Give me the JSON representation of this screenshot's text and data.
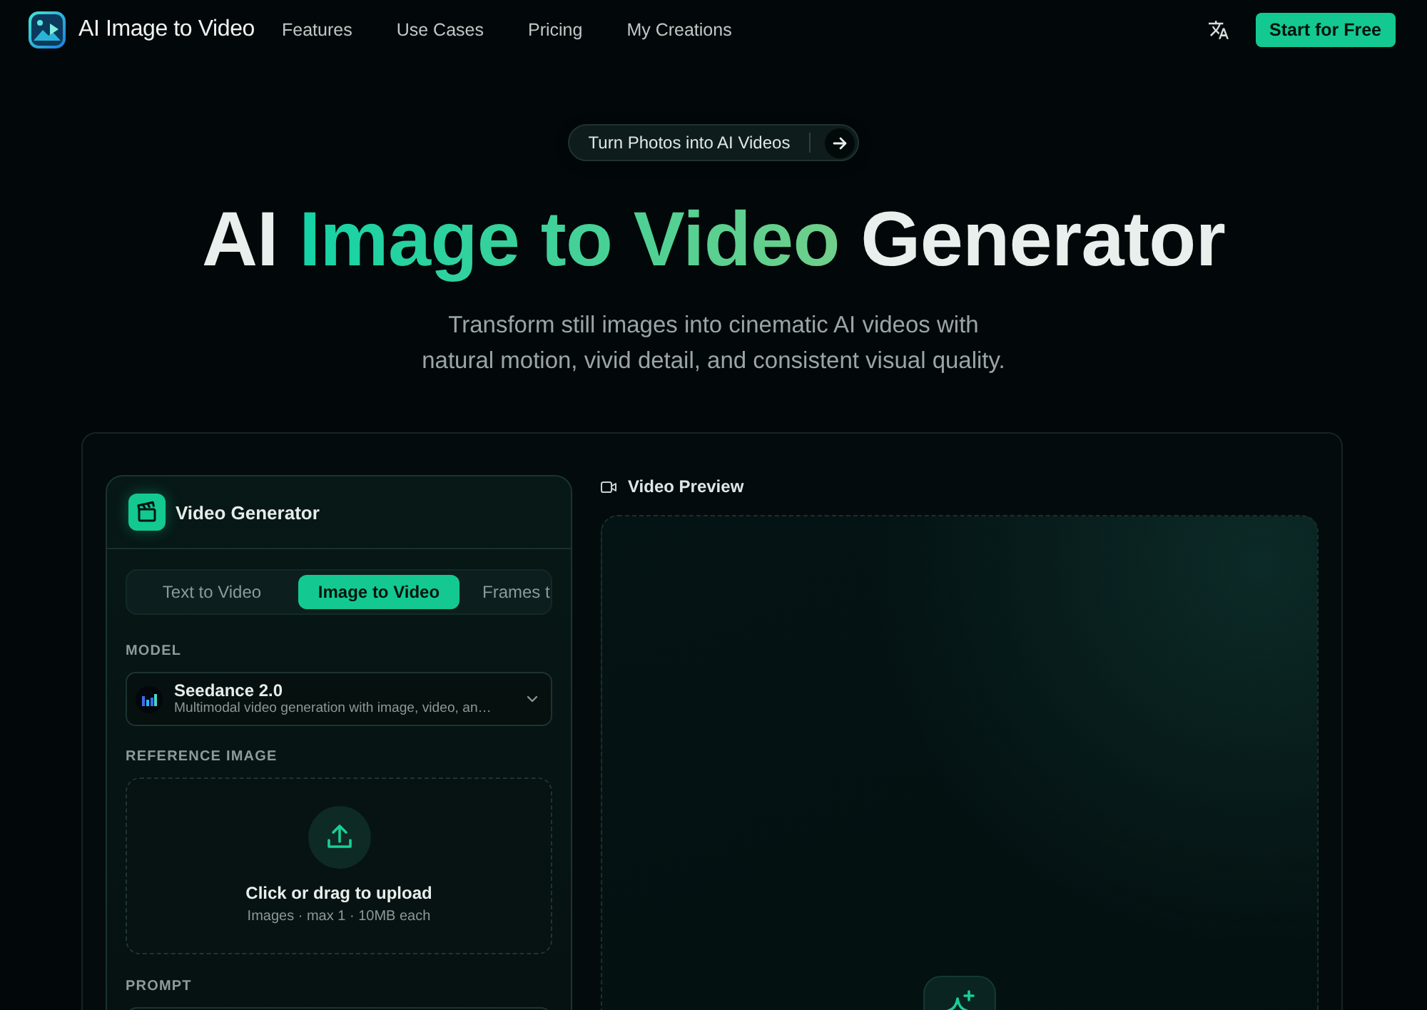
{
  "header": {
    "brand": "AI Image to Video",
    "nav": [
      "Features",
      "Use Cases",
      "Pricing",
      "My Creations"
    ],
    "cta": "Start for Free"
  },
  "hero": {
    "badge": "Turn Photos into AI Videos",
    "title": [
      {
        "text": "AI ",
        "highlight": false
      },
      {
        "text": "Image to Video",
        "highlight": true
      },
      {
        "text": " Generator",
        "highlight": false
      }
    ],
    "subtitle": "Transform still images into cinematic AI videos with\nnatural motion, vivid detail, and consistent visual quality."
  },
  "generator": {
    "title": "Video Generator",
    "tabs": [
      {
        "label": "Text to Video",
        "selected": false
      },
      {
        "label": "Image to Video",
        "selected": true
      },
      {
        "label": "Frames t",
        "selected": false
      }
    ],
    "model": {
      "label": "MODEL",
      "name": "Seedance 2.0",
      "description": "Multimodal video generation with image, video, an…"
    },
    "reference": {
      "label": "REFERENCE IMAGE",
      "title": "Click or drag to upload",
      "hint": "Images · max 1 · 10MB each"
    },
    "prompt": {
      "label": "PROMPT"
    }
  },
  "preview": {
    "title": "Video Preview"
  }
}
